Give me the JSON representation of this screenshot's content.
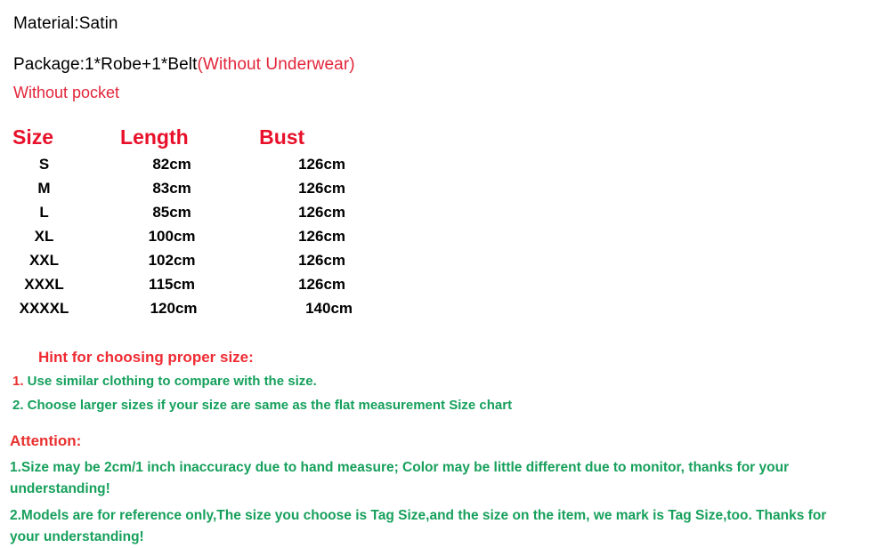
{
  "intro": {
    "material": "Material:Satin",
    "package_black": "Package:1*Robe+1*Belt",
    "package_red": "(Without Underwear)",
    "pocket": "Without pocket"
  },
  "size_chart": {
    "headers": [
      "Size",
      "Length",
      "Bust"
    ],
    "rows": [
      [
        "S",
        "82cm",
        "126cm"
      ],
      [
        "M",
        "83cm",
        "126cm"
      ],
      [
        "L",
        "85cm",
        "126cm"
      ],
      [
        "XL",
        "100cm",
        "126cm"
      ],
      [
        "XXL",
        "102cm",
        "126cm"
      ],
      [
        "XXXL",
        "115cm",
        "126cm"
      ],
      [
        "XXXXL",
        "120cm",
        "140cm"
      ]
    ]
  },
  "hint": {
    "title": "Hint for choosing proper size:",
    "item1_num": "1.",
    "item1_text": " Use similar clothing to compare with the size.",
    "item2_num": "2.",
    "item2_text": " Choose larger sizes if your size are same as the flat measurement Size chart"
  },
  "attention": {
    "title": "Attention:",
    "item1": "1.Size may be 2cm/1 inch inaccuracy due to hand measure; Color may be little different   due to monitor, thanks for your understanding!",
    "item2": "2.Models are for reference only,The size you choose is Tag Size,and the size on the item,  we mark is Tag Size,too. Thanks for your understanding!"
  },
  "colors": {
    "red": "#e8102a",
    "red_soft": "#e2253a",
    "green": "#15a05c",
    "black": "#000000",
    "background": "#ffffff"
  }
}
